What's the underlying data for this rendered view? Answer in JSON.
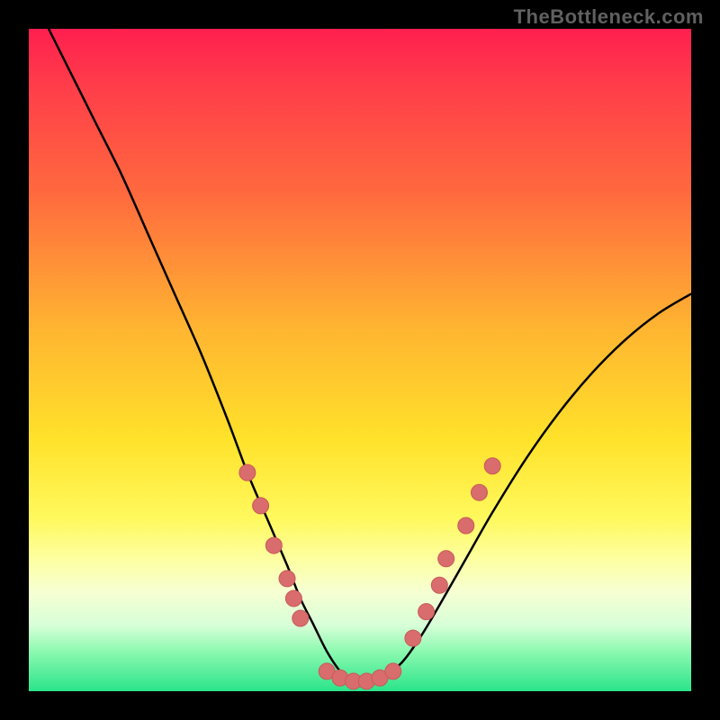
{
  "attribution": "TheBottleneck.com",
  "colors": {
    "page_bg": "#000000",
    "curve": "#000000",
    "marker_fill": "#d96c6c",
    "marker_stroke": "#c95a5a",
    "gradient_stops": [
      "#ff1f4f",
      "#ff3b4a",
      "#ff6a3e",
      "#ffb431",
      "#ffe22a",
      "#fff95e",
      "#fdffa0",
      "#f6ffd2",
      "#d8ffd8",
      "#8cf9b0",
      "#2ae48a"
    ]
  },
  "chart_data": {
    "type": "line",
    "title": "",
    "xlabel": "",
    "ylabel": "",
    "xlim": [
      0,
      100
    ],
    "ylim": [
      0,
      100
    ],
    "grid": false,
    "series": [
      {
        "name": "bottleneck-curve",
        "x": [
          3,
          6,
          10,
          14,
          18,
          22,
          26,
          30,
          33,
          36,
          39,
          41,
          43,
          45,
          47,
          49,
          51,
          53,
          56,
          59,
          62,
          66,
          70,
          75,
          80,
          85,
          90,
          95,
          100
        ],
        "y": [
          100,
          94,
          86,
          78,
          69,
          60,
          51,
          41,
          33,
          26,
          19,
          14,
          10,
          6,
          3,
          1,
          1,
          2,
          4,
          8,
          13,
          20,
          27,
          35,
          42,
          48,
          53,
          57,
          60
        ]
      }
    ],
    "markers": [
      {
        "x": 33,
        "y": 33
      },
      {
        "x": 35,
        "y": 28
      },
      {
        "x": 37,
        "y": 22
      },
      {
        "x": 39,
        "y": 17
      },
      {
        "x": 40,
        "y": 14
      },
      {
        "x": 41,
        "y": 11
      },
      {
        "x": 45,
        "y": 3
      },
      {
        "x": 47,
        "y": 2
      },
      {
        "x": 49,
        "y": 1.5
      },
      {
        "x": 51,
        "y": 1.5
      },
      {
        "x": 53,
        "y": 2
      },
      {
        "x": 55,
        "y": 3
      },
      {
        "x": 58,
        "y": 8
      },
      {
        "x": 60,
        "y": 12
      },
      {
        "x": 62,
        "y": 16
      },
      {
        "x": 63,
        "y": 20
      },
      {
        "x": 66,
        "y": 25
      },
      {
        "x": 68,
        "y": 30
      },
      {
        "x": 70,
        "y": 34
      }
    ]
  }
}
